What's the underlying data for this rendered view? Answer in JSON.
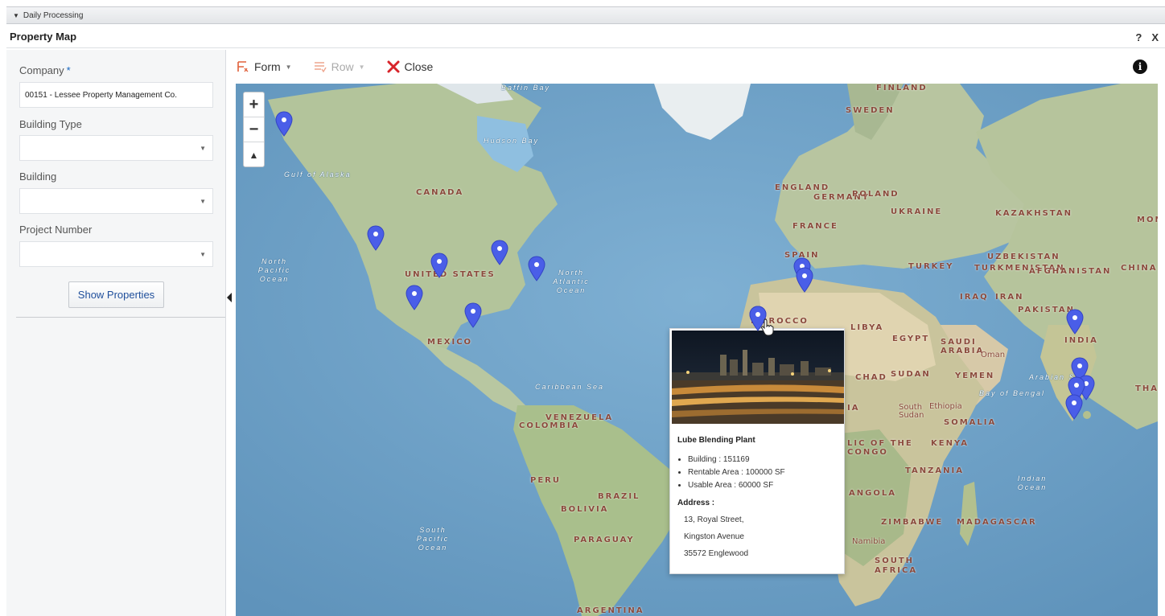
{
  "section_bar": {
    "label": "Daily Processing"
  },
  "window": {
    "title": "Property Map",
    "help": "?",
    "close": "X"
  },
  "filters": {
    "company": {
      "label": "Company",
      "required_mark": "*",
      "value": "00151 - Lessee Property Management Co."
    },
    "building_type": {
      "label": "Building Type",
      "value": ""
    },
    "building": {
      "label": "Building",
      "value": ""
    },
    "project_number": {
      "label": "Project Number",
      "value": ""
    },
    "show_button": "Show Properties"
  },
  "toolbar": {
    "form": "Form",
    "row": "Row",
    "close": "Close",
    "info": "i"
  },
  "map": {
    "zoom_in": "+",
    "zoom_out": "−",
    "reset_north": "▲",
    "ocean_color": "#6d9fc4",
    "land_color": "#b8c7a1",
    "marker_color": "#4a5ee8",
    "countries": [
      "CANADA",
      "UNITED STATES",
      "MEXICO",
      "VENEZUELA",
      "COLOMBIA",
      "PERU",
      "BRAZIL",
      "BOLIVIA",
      "PARAGUAY",
      "ARGENTINA",
      "FINLAND",
      "SWEDEN",
      "ENGLAND",
      "GERMANY",
      "POLAND",
      "UKRAINE",
      "FRANCE",
      "SPAIN",
      "MOROCCO",
      "LIBYA",
      "EGYPT",
      "TURKEY",
      "KAZAKHSTAN",
      "UZBEKISTAN",
      "TURKMENISTAN",
      "AFGHANISTAN",
      "PAKISTAN",
      "IRAQ",
      "IRAN",
      "SAUDI ARABIA",
      "INDIA",
      "CHINA",
      "MON",
      "THAI",
      "YEMEN",
      "Oman",
      "CHAD",
      "SUDAN",
      "South Sudan",
      "Ethiopia",
      "SOMALIA",
      "KENYA",
      "TANZANIA",
      "ANGOLA",
      "ZIMBABWE",
      "MADAGASCAR",
      "Namibia",
      "SOUTH AFRICA",
      "IA",
      "LIC OF THE CONGO"
    ],
    "water": [
      "Hudson Bay",
      "Gulf of Alaska",
      "Caribbean Sea",
      "Arabian Sea",
      "Bay of Bengal",
      "Baffin Bay",
      "Hudson Bay"
    ],
    "oceans": [
      "North Pacific Ocean",
      "North Atlantic Ocean",
      "South Pacific Ocean",
      "Indian Ocean"
    ]
  },
  "popup": {
    "name": "Lube Blending Plant",
    "details": [
      "Building : 151169",
      "Rentable Area : 100000 SF",
      "Usable Area : 60000 SF"
    ],
    "address_heading": "Address :",
    "address_lines": [
      "13, Royal Street,",
      "Kingston Avenue",
      "35572 Englewood"
    ]
  }
}
